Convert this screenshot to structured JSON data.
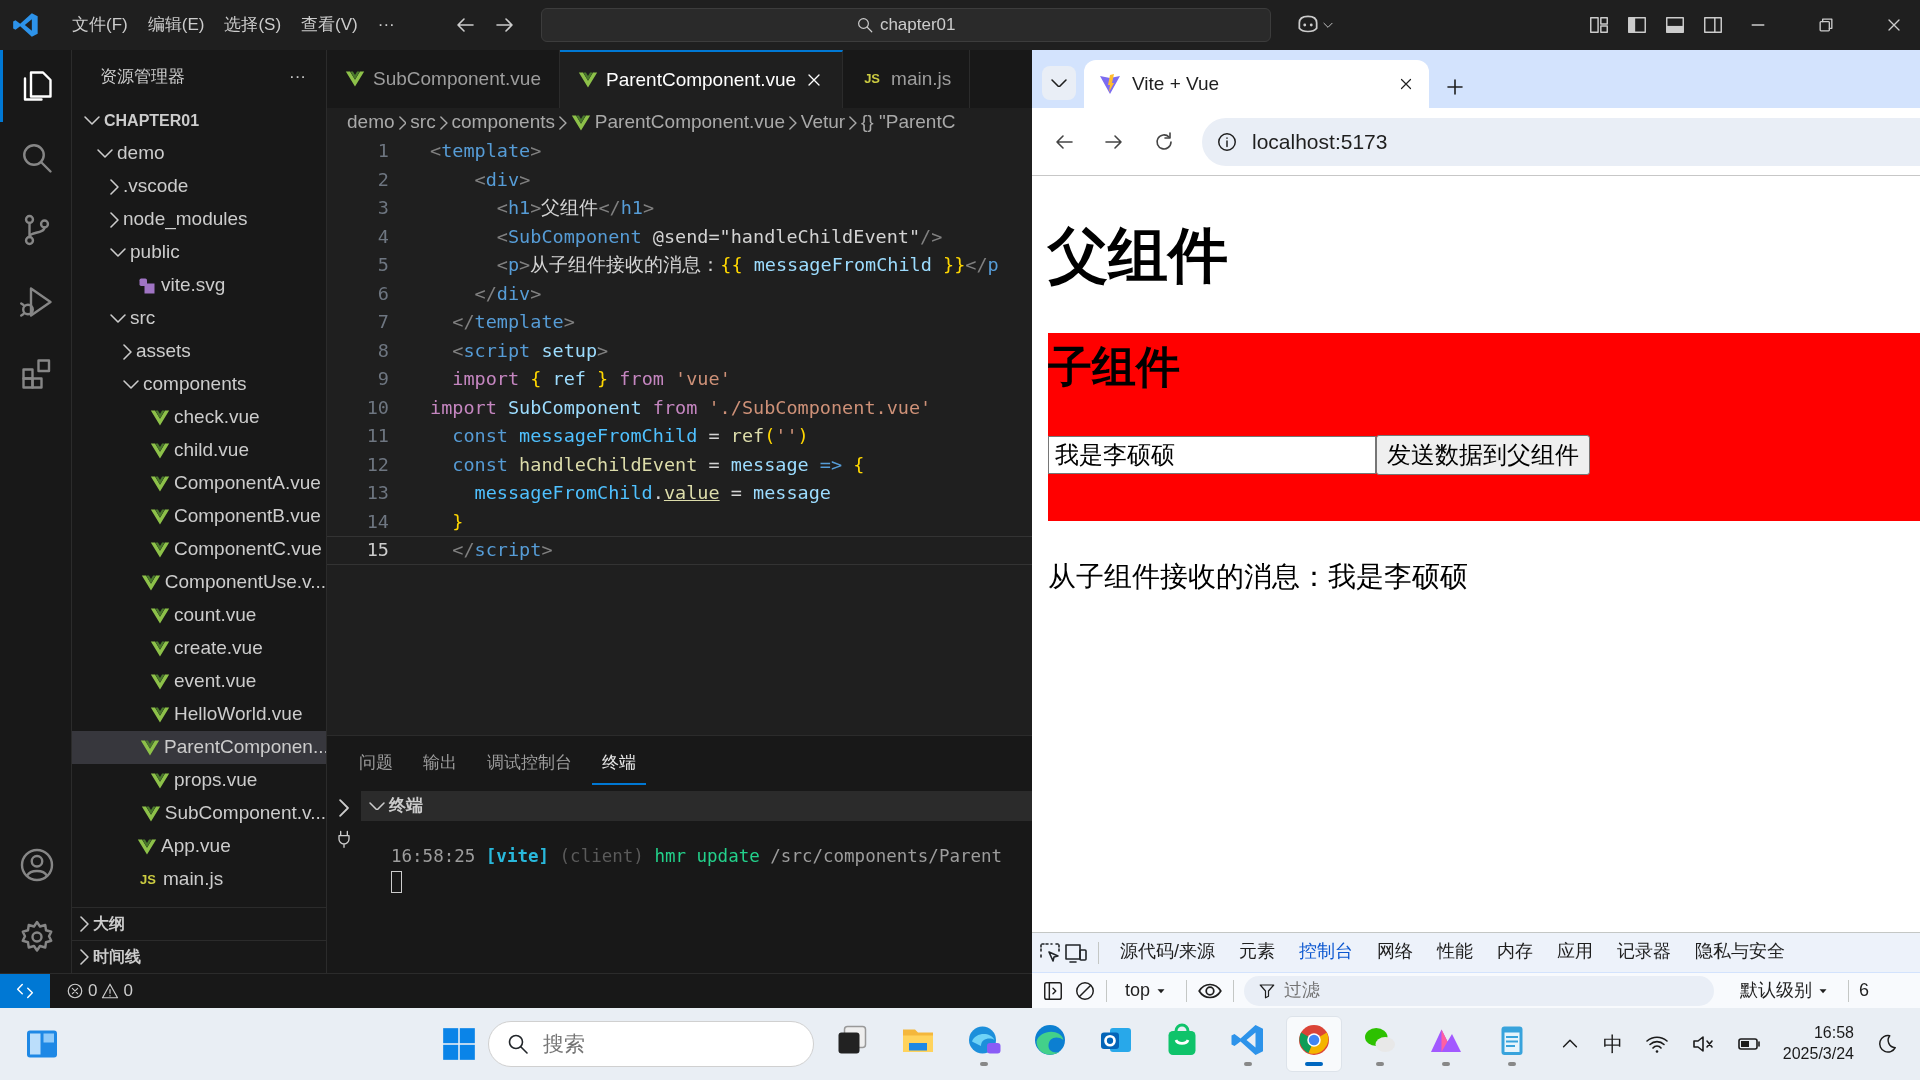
{
  "titlebar": {
    "menus": [
      "文件(F)",
      "编辑(E)",
      "选择(S)",
      "查看(V)",
      "···"
    ],
    "search": "chapter01"
  },
  "activity": {
    "top": [
      {
        "kind": "files",
        "selected": true
      },
      {
        "kind": "search",
        "selected": false
      },
      {
        "kind": "branch",
        "selected": false
      },
      {
        "kind": "debug",
        "selected": false
      },
      {
        "kind": "extensions",
        "selected": false
      }
    ],
    "bottom": [
      {
        "kind": "account"
      },
      {
        "kind": "settings"
      }
    ]
  },
  "sidebar": {
    "title": "资源管理器",
    "more": "···",
    "root": {
      "label": "CHAPTER01",
      "expanded": true
    },
    "tree": [
      {
        "label": "demo",
        "kind": "folder",
        "expanded": true,
        "selected": false,
        "children": [
          {
            "label": ".vscode",
            "kind": "folder",
            "expanded": false,
            "selected": false
          },
          {
            "label": "node_modules",
            "kind": "folder",
            "expanded": false,
            "selected": false
          },
          {
            "label": "public",
            "kind": "folder",
            "expanded": true,
            "selected": false,
            "children": [
              {
                "label": "vite.svg",
                "kind": "svg",
                "selected": false
              }
            ]
          },
          {
            "label": "src",
            "kind": "folder",
            "expanded": true,
            "selected": false,
            "children": [
              {
                "label": "assets",
                "kind": "folder",
                "expanded": false,
                "selected": false
              },
              {
                "label": "components",
                "kind": "folder",
                "expanded": true,
                "selected": false,
                "children": [
                  {
                    "label": "check.vue",
                    "kind": "vue",
                    "selected": false
                  },
                  {
                    "label": "child.vue",
                    "kind": "vue",
                    "selected": false
                  },
                  {
                    "label": "ComponentA.vue",
                    "kind": "vue",
                    "selected": false
                  },
                  {
                    "label": "ComponentB.vue",
                    "kind": "vue",
                    "selected": false
                  },
                  {
                    "label": "ComponentC.vue",
                    "kind": "vue",
                    "selected": false
                  },
                  {
                    "label": "ComponentUse.v...",
                    "kind": "vue",
                    "selected": false
                  },
                  {
                    "label": "count.vue",
                    "kind": "vue",
                    "selected": false
                  },
                  {
                    "label": "create.vue",
                    "kind": "vue",
                    "selected": false
                  },
                  {
                    "label": "event.vue",
                    "kind": "vue",
                    "selected": false
                  },
                  {
                    "label": "HelloWorld.vue",
                    "kind": "vue",
                    "selected": false
                  },
                  {
                    "label": "ParentComponen...",
                    "kind": "vue",
                    "selected": true
                  },
                  {
                    "label": "props.vue",
                    "kind": "vue",
                    "selected": false
                  },
                  {
                    "label": "SubComponent.v...",
                    "kind": "vue",
                    "selected": false
                  }
                ]
              },
              {
                "label": "App.vue",
                "kind": "vue",
                "selected": false
              },
              {
                "label": "main.js",
                "kind": "js",
                "badge": "JS",
                "selected": false
              }
            ]
          }
        ]
      }
    ],
    "sections": [
      {
        "label": "大纲",
        "expanded": false
      },
      {
        "label": "时间线",
        "expanded": false
      }
    ]
  },
  "editor": {
    "tabs": [
      {
        "label": "SubComponent.vue",
        "kind": "vue",
        "selected": false
      },
      {
        "label": "ParentComponent.vue",
        "kind": "vue",
        "selected": true
      },
      {
        "label": "main.js",
        "kind": "js",
        "badge": "JS",
        "selected": false
      }
    ],
    "breadcrumb": [
      {
        "label": "demo",
        "kind": "text"
      },
      {
        "label": "src",
        "kind": "text"
      },
      {
        "label": "components",
        "kind": "text"
      },
      {
        "label": "ParentComponent.vue",
        "kind": "vue"
      },
      {
        "label": "Vetur",
        "kind": "text"
      },
      {
        "label": "{} \"ParentC",
        "kind": "text"
      }
    ],
    "lines": [
      {
        "number": "1",
        "current": false,
        "tokens": [
          {
            "text": "<",
            "kind": "p"
          },
          {
            "text": "template",
            "kind": "tag"
          },
          {
            "text": ">",
            "kind": "p"
          }
        ]
      },
      {
        "number": "2",
        "current": false,
        "tokens": [
          {
            "text": "    <",
            "kind": "p"
          },
          {
            "text": "div",
            "kind": "tag"
          },
          {
            "text": ">",
            "kind": "p"
          }
        ]
      },
      {
        "number": "3",
        "current": false,
        "tokens": [
          {
            "text": "      <",
            "kind": "p"
          },
          {
            "text": "h1",
            "kind": "tag"
          },
          {
            "text": ">",
            "kind": "p"
          },
          {
            "text": "父组件",
            "kind": "tx"
          },
          {
            "text": "</",
            "kind": "p"
          },
          {
            "text": "h1",
            "kind": "tag"
          },
          {
            "text": ">",
            "kind": "p"
          }
        ]
      },
      {
        "number": "4",
        "current": false,
        "tokens": [
          {
            "text": "      <",
            "kind": "p"
          },
          {
            "text": "SubComponent",
            "kind": "tag"
          },
          {
            "text": " @send=\"handleChildEvent\"",
            "kind": "tx"
          },
          {
            "text": "/>",
            "kind": "p"
          }
        ]
      },
      {
        "number": "5",
        "current": false,
        "tokens": [
          {
            "text": "      <",
            "kind": "p"
          },
          {
            "text": "p",
            "kind": "tag"
          },
          {
            "text": ">",
            "kind": "p"
          },
          {
            "text": "从子组件接收的消息：",
            "kind": "tx"
          },
          {
            "text": "{{",
            "kind": "br"
          },
          {
            "text": " messageFromChild ",
            "kind": "var"
          },
          {
            "text": "}}",
            "kind": "br"
          },
          {
            "text": "</",
            "kind": "p"
          },
          {
            "text": "p",
            "kind": "tag"
          }
        ]
      },
      {
        "number": "6",
        "current": false,
        "tokens": [
          {
            "text": "    </",
            "kind": "p"
          },
          {
            "text": "div",
            "kind": "tag"
          },
          {
            "text": ">",
            "kind": "p"
          }
        ]
      },
      {
        "number": "7",
        "current": false,
        "tokens": [
          {
            "text": "  </",
            "kind": "p"
          },
          {
            "text": "template",
            "kind": "tag"
          },
          {
            "text": ">",
            "kind": "p"
          }
        ]
      },
      {
        "number": "8",
        "current": false,
        "tokens": [
          {
            "text": "  <",
            "kind": "p"
          },
          {
            "text": "script",
            "kind": "tag"
          },
          {
            "text": " setup",
            "kind": "attr"
          },
          {
            "text": ">",
            "kind": "p"
          }
        ]
      },
      {
        "number": "9",
        "current": false,
        "tokens": [
          {
            "text": "  import",
            "kind": "kw"
          },
          {
            "text": " {",
            "kind": "br"
          },
          {
            "text": " ref ",
            "kind": "var"
          },
          {
            "text": "}",
            "kind": "br"
          },
          {
            "text": " from",
            "kind": "kw"
          },
          {
            "text": " 'vue'",
            "kind": "str"
          }
        ]
      },
      {
        "number": "10",
        "current": false,
        "tokens": [
          {
            "text": "import",
            "kind": "kw"
          },
          {
            "text": " SubComponent ",
            "kind": "var"
          },
          {
            "text": "from",
            "kind": "kw"
          },
          {
            "text": " './SubComponent.vue'",
            "kind": "str"
          }
        ]
      },
      {
        "number": "11",
        "current": false,
        "tokens": [
          {
            "text": "  const",
            "kind": "key"
          },
          {
            "text": " messageFromChild",
            "kind": "var2"
          },
          {
            "text": " = ",
            "kind": "tx"
          },
          {
            "text": "ref",
            "kind": "fn"
          },
          {
            "text": "(",
            "kind": "br"
          },
          {
            "text": "''",
            "kind": "str"
          },
          {
            "text": ")",
            "kind": "br"
          }
        ]
      },
      {
        "number": "12",
        "current": false,
        "tokens": [
          {
            "text": "  const",
            "kind": "key"
          },
          {
            "text": " handleChildEvent",
            "kind": "fn"
          },
          {
            "text": " = ",
            "kind": "tx"
          },
          {
            "text": "message",
            "kind": "var"
          },
          {
            "text": " =>",
            "kind": "key"
          },
          {
            "text": " {",
            "kind": "br"
          }
        ]
      },
      {
        "number": "13",
        "current": false,
        "tokens": [
          {
            "text": "    messageFromChild",
            "kind": "var2"
          },
          {
            "text": ".",
            "kind": "tx"
          },
          {
            "text": "value",
            "kind": "und"
          },
          {
            "text": " = ",
            "kind": "tx"
          },
          {
            "text": "message",
            "kind": "var"
          }
        ]
      },
      {
        "number": "14",
        "current": false,
        "tokens": [
          {
            "text": "  }",
            "kind": "br"
          }
        ]
      },
      {
        "number": "15",
        "current": true,
        "tokens": [
          {
            "text": "  </",
            "kind": "p"
          },
          {
            "text": "script",
            "kind": "tag"
          },
          {
            "text": ">",
            "kind": "p"
          }
        ]
      }
    ]
  },
  "panel": {
    "tabs": [
      {
        "label": "问题",
        "selected": false
      },
      {
        "label": "输出",
        "selected": false
      },
      {
        "label": "调试控制台",
        "selected": false
      },
      {
        "label": "终端",
        "selected": true
      }
    ],
    "section": {
      "label": "终端",
      "expanded": true
    },
    "terminal": [
      {
        "text": "16:58:25 ",
        "kind": "dim"
      },
      {
        "text": "[vite]",
        "kind": "vite"
      },
      {
        "text": " (client) ",
        "kind": "faint"
      },
      {
        "text": "hmr update ",
        "kind": "ok"
      },
      {
        "text": "/src/components/Parent",
        "kind": "dim"
      }
    ]
  },
  "status": {
    "errors": "0",
    "warnings": "0"
  },
  "browser": {
    "tab": {
      "title": "Vite + Vue"
    },
    "address": "localhost:5173",
    "page": {
      "heading": "父组件",
      "child": {
        "heading": "子组件",
        "input": "我是李硕硕",
        "button": "发送数据到父组件"
      },
      "message": "从子组件接收的消息：我是李硕硕"
    },
    "devtools": {
      "tabs": [
        {
          "label": "源代码/来源",
          "selected": false
        },
        {
          "label": "元素",
          "selected": false
        },
        {
          "label": "控制台",
          "selected": true
        },
        {
          "label": "网络",
          "selected": false
        },
        {
          "label": "性能",
          "selected": false
        },
        {
          "label": "内存",
          "selected": false
        },
        {
          "label": "应用",
          "selected": false
        },
        {
          "label": "记录器",
          "selected": false
        },
        {
          "label": "隐私与安全",
          "selected": false
        }
      ],
      "context": "top",
      "filter_placeholder": "过滤",
      "level": "默认级别",
      "issues": "6"
    }
  },
  "taskbar": {
    "search_placeholder": "搜索",
    "apps": [
      {
        "kind": "taskview",
        "running": false,
        "selected": false
      },
      {
        "kind": "explorer",
        "running": false,
        "selected": false
      },
      {
        "kind": "edgeai",
        "running": true,
        "selected": false
      },
      {
        "kind": "edge",
        "running": false,
        "selected": false
      },
      {
        "kind": "outlook",
        "running": false,
        "selected": false
      },
      {
        "kind": "store",
        "running": false,
        "selected": false
      },
      {
        "kind": "vscode",
        "running": true,
        "selected": false
      },
      {
        "kind": "chrome",
        "running": true,
        "selected": true
      },
      {
        "kind": "wechat",
        "running": true,
        "selected": false
      },
      {
        "kind": "paint",
        "running": true,
        "selected": false
      },
      {
        "kind": "notepad",
        "running": true,
        "selected": false
      }
    ],
    "ime": "中",
    "time": "16:58",
    "date": "2025/3/24"
  }
}
